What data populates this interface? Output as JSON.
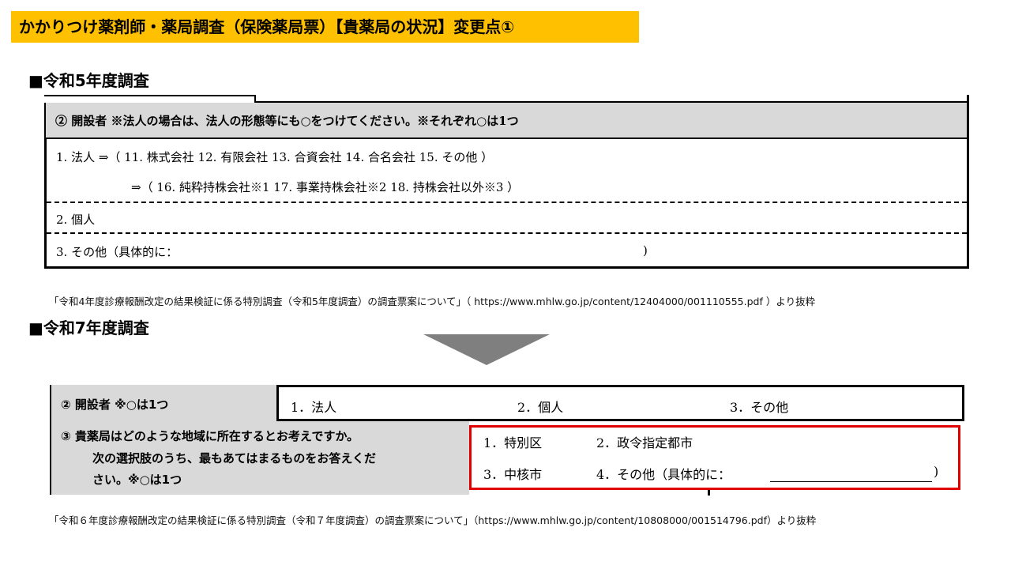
{
  "title": "かかりつけ薬剤師・薬局調査（保険薬局票）【貴薬局の状況】変更点①",
  "r5": {
    "heading": "■令和5年度調査",
    "question": "②  開設者  ※法人の場合は、法人の形態等にも○をつけてください。※それぞれ○は1つ",
    "row1": "1.  法人    ⇒（   11.  株式会社   12.  有限会社   13.  合資会社   14.  合名会社   15.  その他   ）",
    "row1b": "⇒（   16.  純粋持株会社※1   17.  事業持株会社※2   18.  持株会社以外※3   ）",
    "row2": "2.  個人",
    "row3": "3.  その他（具体的に：",
    "row3_close": ")",
    "source": "「令和4年度診療報酬改定の結果検証に係る特別調査（令和5年度調査）の調査票案について」（ https://www.mhlw.go.jp/content/12404000/001110555.pdf ）より抜粋"
  },
  "r7": {
    "heading": "■令和7年度調査",
    "q2_label": "②  開設者  ※○は1つ",
    "q2_opt1": "1．法人",
    "q2_opt2": "2．個人",
    "q2_opt3": "3．その他",
    "q3_line1": "③  貴薬局はどのような地域に所在するとお考えですか。",
    "q3_line2": "次の選択肢のうち、最もあてはまるものをお答えくだ",
    "q3_line3": "さい。※○は1つ",
    "q3_opt1": "1．特別区",
    "q3_opt2": "2．政令指定都市",
    "q3_opt3": "3．中核市",
    "q3_opt4": "4．その他（具体的に：",
    "q3_close": ")",
    "source": "「令和６年度診療報酬改定の結果検証に係る特別調査（令和７年度調査）の調査票案について」（https://www.mhlw.go.jp/content/10808000/001514796.pdf）より抜粋"
  },
  "colors": {
    "title_bg": "#ffc000",
    "gray": "#d9d9d9",
    "highlight": "#e00000",
    "arrow": "#7f7f7f"
  }
}
